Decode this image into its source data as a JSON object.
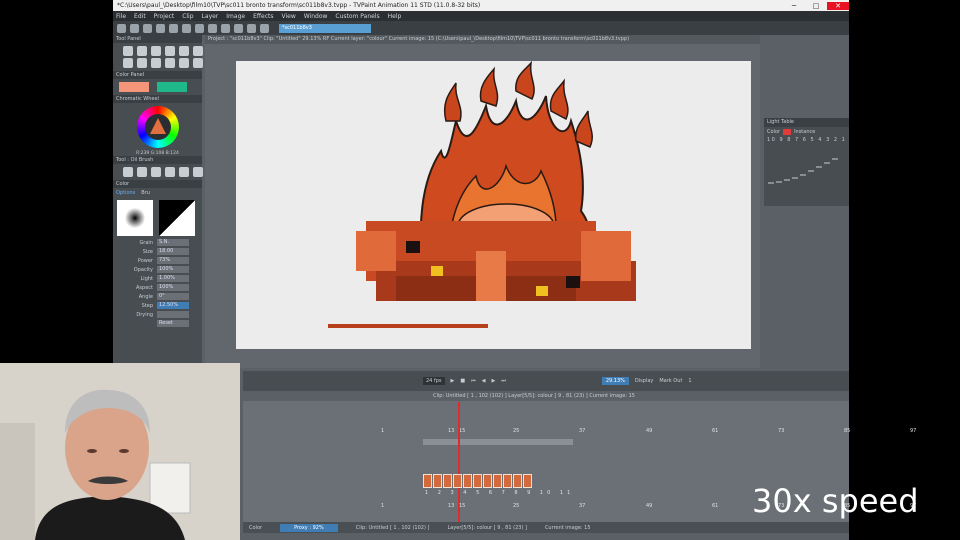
{
  "window": {
    "title": "*C:\\Users\\paul_\\Desktop\\film10\\TVP\\sc011 bronto transform\\sc011b8v3.tvpp - TVPaint Animation 11 STD (11.0.8-32 bits)",
    "minimize": "─",
    "maximize": "□",
    "close": "✕"
  },
  "menu": [
    "File",
    "Edit",
    "Project",
    "Clip",
    "Layer",
    "Image",
    "Effects",
    "View",
    "Window",
    "Custom Panels",
    "Help"
  ],
  "toolbar": {
    "search_value": "*sc011b8v3"
  },
  "left_panel": {
    "tool_panel_title": "Tool Panel",
    "color_panel_title": "Color Panel",
    "color_a": "#f4957a",
    "color_b": "#1fb88a",
    "wheel_title": "Chromatic Wheel",
    "rgb_readout": "R:239 G:108 B:124",
    "brush_title": "Tool : Oil Brush",
    "color_label": "Color",
    "tabs": [
      "Options",
      "Bru"
    ],
    "params": [
      {
        "label": "Grain",
        "value": "S.N."
      },
      {
        "label": "Size",
        "value": "18.00"
      },
      {
        "label": "Power",
        "value": "73%"
      },
      {
        "label": "Opacity",
        "value": "100%"
      },
      {
        "label": "Light",
        "value": "1.00%"
      },
      {
        "label": "Aspect",
        "value": "100%"
      },
      {
        "label": "Angle",
        "value": "0°"
      },
      {
        "label": "Step",
        "value": "12.50%"
      },
      {
        "label": "Drying",
        "value": ""
      }
    ],
    "reset_label": "Reset"
  },
  "document": {
    "header": "Project : \"sc011b8v3\"   Clip: \"Untitled\"   29.13%   RF   Current layer: \"colour\"   Current image: 15 (C:\\Users\\paul_\\Desktop\\film10\\TVP\\sc011 bronto transform\\sc011b8v3.tvpp)"
  },
  "light_table": {
    "title": "Light Table",
    "color_label": "Color",
    "instance_label": "Instance",
    "numbers": "10 9 8 7 6 5 4 3 2 1",
    "accent": "#e03b3b"
  },
  "transport": {
    "fps": "24 fps",
    "zoom": "29.13%",
    "display_label": "Display",
    "mark_out": "Mark Out",
    "mark_out_value": "1"
  },
  "timeline": {
    "info": "Clip: Untitled [ 1 , 102 (102) ]        Layer[5/5]: colour [ 9 , 81 (23) ]        Current image: 15",
    "ruler_marks": [
      "1",
      "13",
      "15",
      "25",
      "37",
      "49",
      "61",
      "73",
      "85",
      "97"
    ],
    "ruler2_marks": [
      "1",
      "13",
      "15",
      "25",
      "37",
      "49",
      "61",
      "73",
      "85",
      "97"
    ],
    "thumb_nums": "1 2 3 4 5 6 7 8 9 10 11"
  },
  "statusbar": {
    "color_label": "Color",
    "proxy": "Proxy : 92%",
    "clip": "Clip: Untitled [ 1 , 102 (102) ]",
    "layer": "Layer[5/5]: colour [ 9 , 81 (23) ]",
    "current_image": "Current image: 15"
  },
  "overlay": {
    "speed_label": "30x speed"
  }
}
